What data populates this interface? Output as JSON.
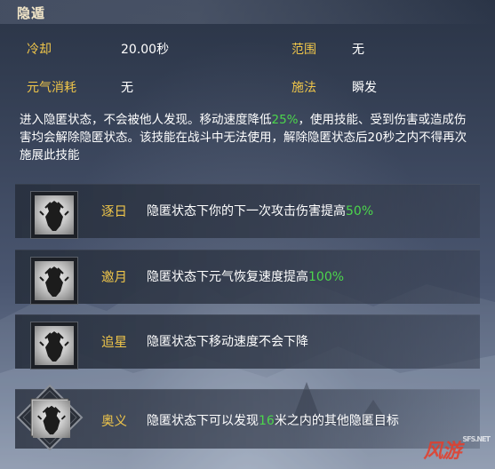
{
  "header": {
    "title": "隐遁"
  },
  "stats": {
    "cooldown_label": "冷却",
    "cooldown_value": "20.00秒",
    "range_label": "范围",
    "range_value": "无",
    "cost_label": "元气消耗",
    "cost_value": "无",
    "cast_label": "施法",
    "cast_value": "瞬发"
  },
  "description": {
    "part1": "进入隐匿状态，不会被他人发现。移动速度降低",
    "highlight": "25%",
    "part2": "，使用技能、受到伤害或造成伤害均会解除隐匿状态。该技能在战斗中无法使用，解除隐匿状态后20秒之内不得再次施展此技能"
  },
  "upgrades": [
    {
      "name": "逐日",
      "text": "隐匿状态下你的下一次攻击伤害提高",
      "value": "50%",
      "icon": "stealth-skill-icon"
    },
    {
      "name": "邀月",
      "text": "隐匿状态下元气恢复速度提高",
      "value": "100%",
      "icon": "stealth-skill-icon"
    },
    {
      "name": "追星",
      "text": "隐匿状态下移动速度不会下降",
      "value": "",
      "icon": "stealth-skill-icon"
    },
    {
      "name": "奥义",
      "text_before": "隐匿状态下可以发现",
      "value": "16",
      "text_after": "米之内的其他隐匿目标",
      "icon": "stealth-skill-icon"
    }
  ],
  "watermark": {
    "main": "风游",
    "sub": "SFS.NET"
  },
  "colors": {
    "label_gold": "#f0c64a",
    "highlight_green": "#4cd64c",
    "text_white": "#ffffff"
  }
}
